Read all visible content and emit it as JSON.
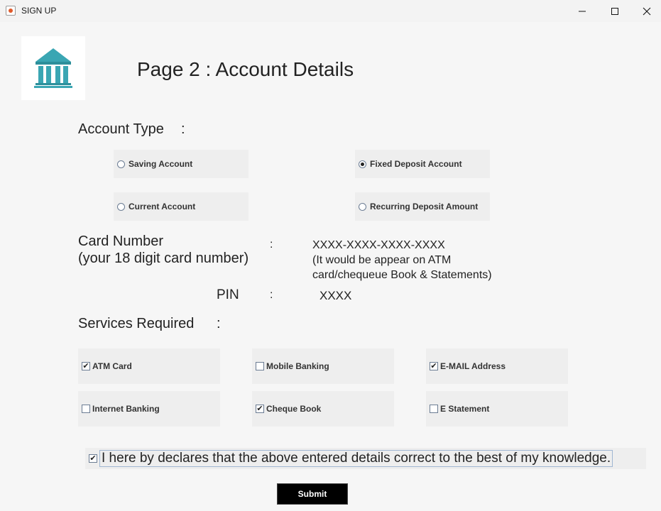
{
  "window": {
    "title": "SIGN UP",
    "controls": [
      "minimize",
      "maximize",
      "close"
    ]
  },
  "page": {
    "heading": "Page 2 : Account Details"
  },
  "account_type": {
    "label": "Account Type",
    "colon": ":",
    "options": [
      {
        "label": "Saving Account",
        "selected": false
      },
      {
        "label": "Fixed Deposit Account",
        "selected": true
      },
      {
        "label": "Current Account",
        "selected": false
      },
      {
        "label": "Recurring Deposit Amount",
        "selected": false
      }
    ]
  },
  "card": {
    "label_line1": "Card Number",
    "label_line2": "(your 18 digit card number)",
    "colon": ":",
    "value": "XXXX-XXXX-XXXX-XXXX",
    "note_line1": "(It would be appear on ATM",
    "note_line2": "card/chequeue Book & Statements)"
  },
  "pin": {
    "label": "PIN",
    "colon": ":",
    "value": "XXXX"
  },
  "services": {
    "label": "Services Required",
    "colon": ":",
    "options": [
      {
        "label": "ATM Card",
        "checked": true
      },
      {
        "label": "Mobile Banking",
        "checked": false
      },
      {
        "label": "E-MAIL Address",
        "checked": true
      },
      {
        "label": "Internet Banking",
        "checked": false
      },
      {
        "label": "Cheque Book",
        "checked": true
      },
      {
        "label": "E Statement",
        "checked": false
      }
    ]
  },
  "declaration": {
    "text": "I here by declares that the above entered details correct to the best of my knowledge.",
    "checked": true
  },
  "submit": {
    "label": "Submit"
  },
  "colors": {
    "logo": "#3aa6b3",
    "option_bg": "#eeeeee",
    "content_bg": "#f6f6f6",
    "submit_bg": "#000000"
  }
}
